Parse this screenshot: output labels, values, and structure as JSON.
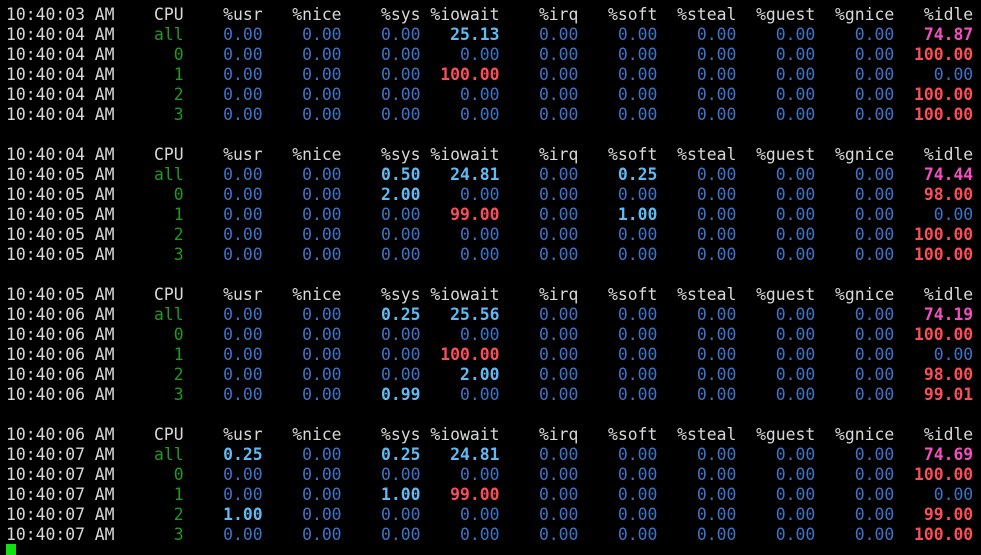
{
  "terminal": {
    "columns": [
      "CPU",
      "%usr",
      "%nice",
      "%sys",
      "%iowait",
      "%irq",
      "%soft",
      "%steal",
      "%guest",
      "%gnice",
      "%idle"
    ],
    "blocks": [
      {
        "header_time": "10:40:03 AM",
        "rows": [
          {
            "time": "10:40:04 AM",
            "cpu": "all",
            "values": [
              "0.00",
              "0.00",
              "0.00",
              "25.13",
              "0.00",
              "0.00",
              "0.00",
              "0.00",
              "0.00",
              "74.87"
            ]
          },
          {
            "time": "10:40:04 AM",
            "cpu": "0",
            "values": [
              "0.00",
              "0.00",
              "0.00",
              "0.00",
              "0.00",
              "0.00",
              "0.00",
              "0.00",
              "0.00",
              "100.00"
            ]
          },
          {
            "time": "10:40:04 AM",
            "cpu": "1",
            "values": [
              "0.00",
              "0.00",
              "0.00",
              "100.00",
              "0.00",
              "0.00",
              "0.00",
              "0.00",
              "0.00",
              "0.00"
            ]
          },
          {
            "time": "10:40:04 AM",
            "cpu": "2",
            "values": [
              "0.00",
              "0.00",
              "0.00",
              "0.00",
              "0.00",
              "0.00",
              "0.00",
              "0.00",
              "0.00",
              "100.00"
            ]
          },
          {
            "time": "10:40:04 AM",
            "cpu": "3",
            "values": [
              "0.00",
              "0.00",
              "0.00",
              "0.00",
              "0.00",
              "0.00",
              "0.00",
              "0.00",
              "0.00",
              "100.00"
            ]
          }
        ]
      },
      {
        "header_time": "10:40:04 AM",
        "rows": [
          {
            "time": "10:40:05 AM",
            "cpu": "all",
            "values": [
              "0.00",
              "0.00",
              "0.50",
              "24.81",
              "0.00",
              "0.25",
              "0.00",
              "0.00",
              "0.00",
              "74.44"
            ]
          },
          {
            "time": "10:40:05 AM",
            "cpu": "0",
            "values": [
              "0.00",
              "0.00",
              "2.00",
              "0.00",
              "0.00",
              "0.00",
              "0.00",
              "0.00",
              "0.00",
              "98.00"
            ]
          },
          {
            "time": "10:40:05 AM",
            "cpu": "1",
            "values": [
              "0.00",
              "0.00",
              "0.00",
              "99.00",
              "0.00",
              "1.00",
              "0.00",
              "0.00",
              "0.00",
              "0.00"
            ]
          },
          {
            "time": "10:40:05 AM",
            "cpu": "2",
            "values": [
              "0.00",
              "0.00",
              "0.00",
              "0.00",
              "0.00",
              "0.00",
              "0.00",
              "0.00",
              "0.00",
              "100.00"
            ]
          },
          {
            "time": "10:40:05 AM",
            "cpu": "3",
            "values": [
              "0.00",
              "0.00",
              "0.00",
              "0.00",
              "0.00",
              "0.00",
              "0.00",
              "0.00",
              "0.00",
              "100.00"
            ]
          }
        ]
      },
      {
        "header_time": "10:40:05 AM",
        "rows": [
          {
            "time": "10:40:06 AM",
            "cpu": "all",
            "values": [
              "0.00",
              "0.00",
              "0.25",
              "25.56",
              "0.00",
              "0.00",
              "0.00",
              "0.00",
              "0.00",
              "74.19"
            ]
          },
          {
            "time": "10:40:06 AM",
            "cpu": "0",
            "values": [
              "0.00",
              "0.00",
              "0.00",
              "0.00",
              "0.00",
              "0.00",
              "0.00",
              "0.00",
              "0.00",
              "100.00"
            ]
          },
          {
            "time": "10:40:06 AM",
            "cpu": "1",
            "values": [
              "0.00",
              "0.00",
              "0.00",
              "100.00",
              "0.00",
              "0.00",
              "0.00",
              "0.00",
              "0.00",
              "0.00"
            ]
          },
          {
            "time": "10:40:06 AM",
            "cpu": "2",
            "values": [
              "0.00",
              "0.00",
              "0.00",
              "2.00",
              "0.00",
              "0.00",
              "0.00",
              "0.00",
              "0.00",
              "98.00"
            ]
          },
          {
            "time": "10:40:06 AM",
            "cpu": "3",
            "values": [
              "0.00",
              "0.00",
              "0.99",
              "0.00",
              "0.00",
              "0.00",
              "0.00",
              "0.00",
              "0.00",
              "99.01"
            ]
          }
        ]
      },
      {
        "header_time": "10:40:06 AM",
        "rows": [
          {
            "time": "10:40:07 AM",
            "cpu": "all",
            "values": [
              "0.25",
              "0.00",
              "0.25",
              "24.81",
              "0.00",
              "0.00",
              "0.00",
              "0.00",
              "0.00",
              "74.69"
            ]
          },
          {
            "time": "10:40:07 AM",
            "cpu": "0",
            "values": [
              "0.00",
              "0.00",
              "0.00",
              "0.00",
              "0.00",
              "0.00",
              "0.00",
              "0.00",
              "0.00",
              "100.00"
            ]
          },
          {
            "time": "10:40:07 AM",
            "cpu": "1",
            "values": [
              "0.00",
              "0.00",
              "1.00",
              "99.00",
              "0.00",
              "0.00",
              "0.00",
              "0.00",
              "0.00",
              "0.00"
            ]
          },
          {
            "time": "10:40:07 AM",
            "cpu": "2",
            "values": [
              "1.00",
              "0.00",
              "0.00",
              "0.00",
              "0.00",
              "0.00",
              "0.00",
              "0.00",
              "0.00",
              "99.00"
            ]
          },
          {
            "time": "10:40:07 AM",
            "cpu": "3",
            "values": [
              "0.00",
              "0.00",
              "0.00",
              "0.00",
              "0.00",
              "0.00",
              "0.00",
              "0.00",
              "0.00",
              "100.00"
            ]
          }
        ]
      }
    ],
    "colors": {
      "background": "#000000",
      "text": "#d8d8d8",
      "cpu_id": "#1e9a1e",
      "value_dim": "#3d74c8",
      "value_highlight": "#62baf4",
      "value_high": "#fa4e58",
      "idle_all": "#f44fc0",
      "cursor": "#11e011"
    }
  }
}
